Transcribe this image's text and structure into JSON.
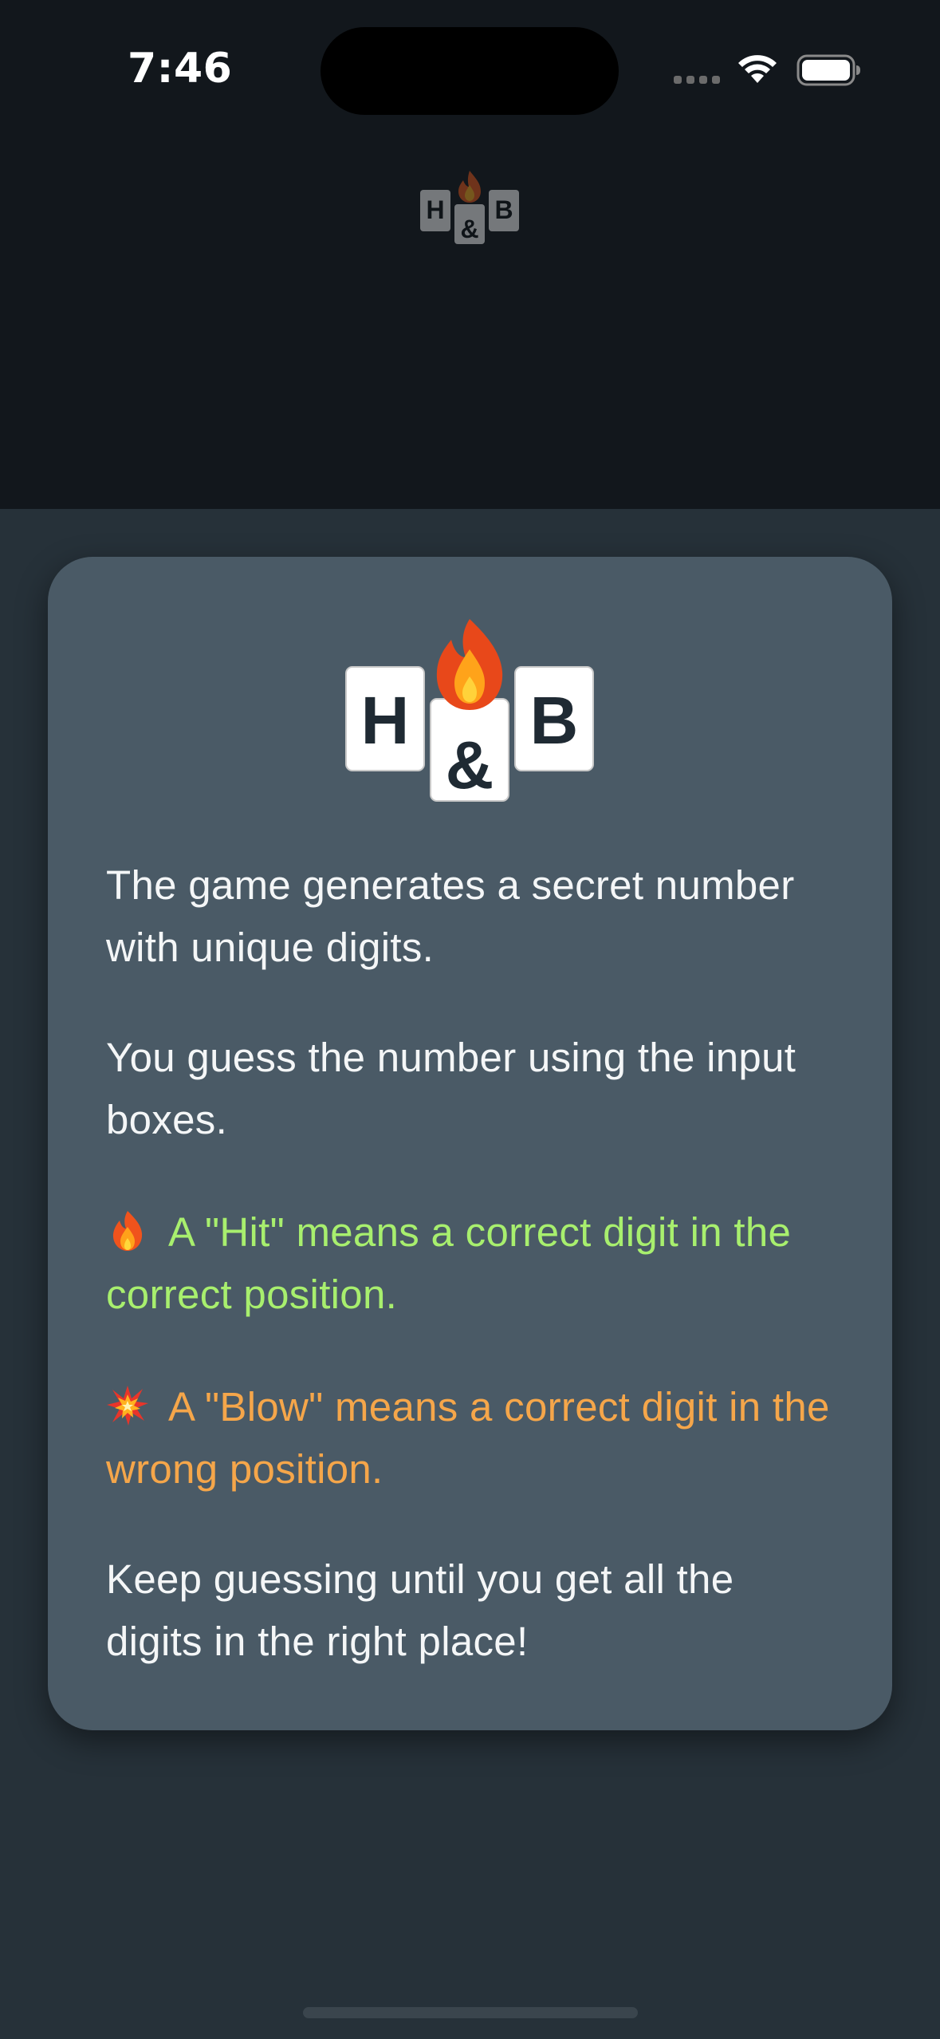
{
  "status_bar": {
    "time": "7:46"
  },
  "colors": {
    "top_background": "#12171c",
    "page_background": "#263139",
    "card_background": "#4a5a66",
    "hit_text": "#a8ef6e",
    "blow_text": "#f5a64a",
    "body_text": "#f4f6f7"
  },
  "logo": {
    "letters": [
      "H",
      "&",
      "B"
    ],
    "icon": "fire-icon"
  },
  "instructions": {
    "p1": "The game generates a secret number with unique digits.",
    "p2": "You guess the number using the input boxes.",
    "hit": {
      "icon": "fire-icon",
      "text": "A \"Hit\" means a correct digit in the correct position."
    },
    "blow": {
      "icon": "collision-icon",
      "text": "A \"Blow\" means a correct digit in the wrong position."
    },
    "p5": "Keep guessing until you get all the digits in the right place!"
  }
}
